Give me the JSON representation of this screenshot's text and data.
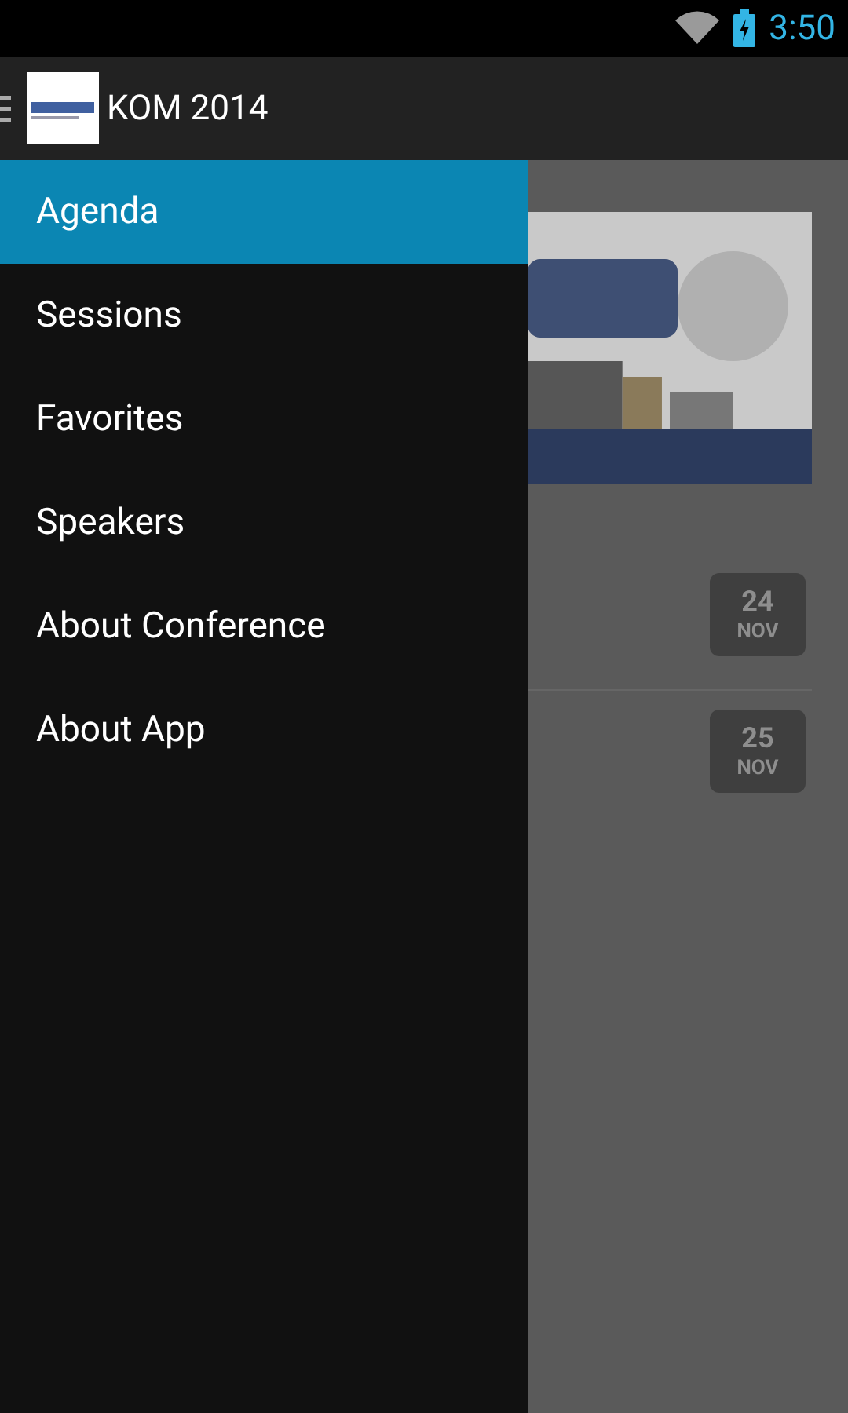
{
  "status_bar": {
    "time": "3:50"
  },
  "app_bar": {
    "title": "KOM 2014"
  },
  "drawer": {
    "items": [
      {
        "label": "Agenda",
        "selected": true
      },
      {
        "label": "Sessions",
        "selected": false
      },
      {
        "label": "Favorites",
        "selected": false
      },
      {
        "label": "Speakers",
        "selected": false
      },
      {
        "label": "About Conference",
        "selected": false
      },
      {
        "label": "About App",
        "selected": false
      }
    ]
  },
  "agenda": {
    "days": [
      {
        "day": "24",
        "month": "NOV"
      },
      {
        "day": "25",
        "month": "NOV"
      }
    ]
  }
}
